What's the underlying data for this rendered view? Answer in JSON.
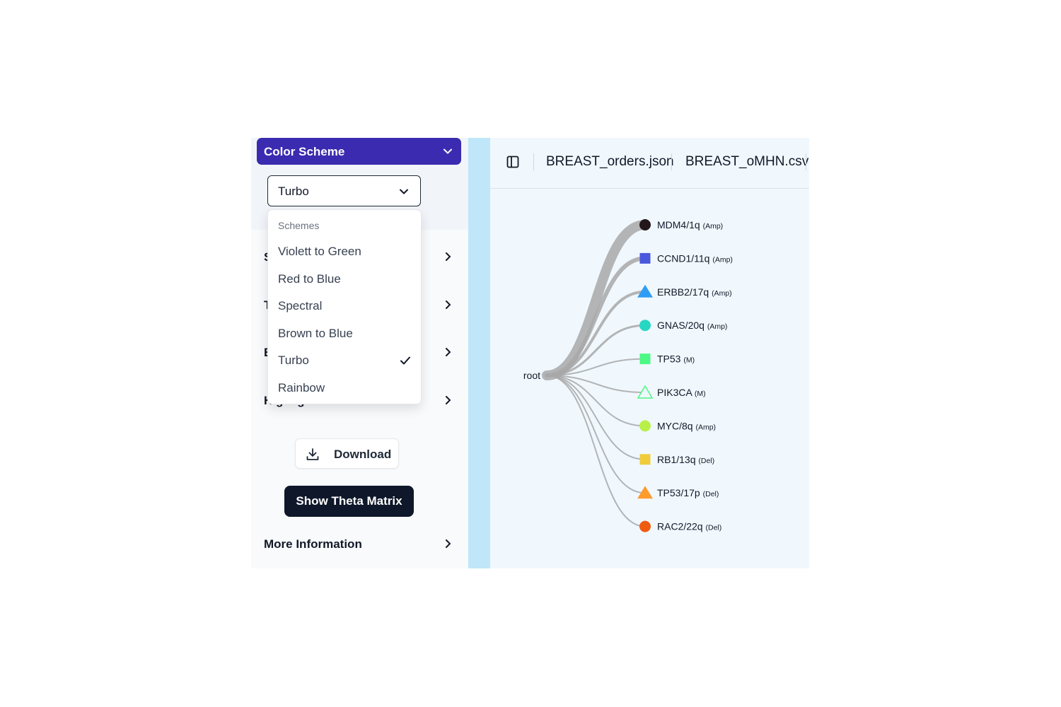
{
  "sidebar": {
    "color_scheme_header": "Color Scheme",
    "selected_scheme": "Turbo",
    "accordion": [
      {
        "label": "S"
      },
      {
        "label": "T"
      },
      {
        "label": "E"
      },
      {
        "label": "Highlight Mutation"
      }
    ],
    "download_label": "Download",
    "theta_label": "Show Theta Matrix",
    "more_info_label": "More Information"
  },
  "scheme_dropdown": {
    "group_label": "Schemes",
    "options": [
      "Violett to Green",
      "Red to Blue",
      "Spectral",
      "Brown to Blue",
      "Turbo",
      "Rainbow"
    ],
    "selected": "Turbo"
  },
  "toolbar": {
    "files": [
      "BREAST_orders.json",
      "BREAST_oMHN.csv"
    ]
  },
  "tree": {
    "root_label": "root",
    "nodes": [
      {
        "name": "MDM4/1q",
        "tag": "(Amp)",
        "shape": "circle",
        "color": "#23171b"
      },
      {
        "name": "CCND1/11q",
        "tag": "(Amp)",
        "shape": "square",
        "color": "#4a58dd"
      },
      {
        "name": "ERBB2/17q",
        "tag": "(Amp)",
        "shape": "triangle",
        "color": "#2f9df5"
      },
      {
        "name": "GNAS/20q",
        "tag": "(Amp)",
        "shape": "circle",
        "color": "#27d7c4"
      },
      {
        "name": "TP53",
        "tag": "(M)",
        "shape": "square",
        "color": "#4df884"
      },
      {
        "name": "PIK3CA",
        "tag": "(M)",
        "shape": "triangle-outline",
        "color": "#4df884"
      },
      {
        "name": "MYC/8q",
        "tag": "(Amp)",
        "shape": "circle",
        "color": "#b8f04a"
      },
      {
        "name": "RB1/13q",
        "tag": "(Del)",
        "shape": "square",
        "color": "#f0cc3a"
      },
      {
        "name": "TP53/17p",
        "tag": "(Del)",
        "shape": "triangle",
        "color": "#fe9b2d"
      },
      {
        "name": "RAC2/22q",
        "tag": "(Del)",
        "shape": "circle",
        "color": "#f05b12"
      }
    ],
    "edge_weights": [
      14,
      6,
      4,
      3,
      2,
      2,
      2,
      2,
      2,
      2
    ]
  },
  "colors": {
    "accent": "#3a2bb0",
    "dark_button": "#0f172a",
    "splitter": "#bfe6f9",
    "edge": "#a8a8a8"
  }
}
